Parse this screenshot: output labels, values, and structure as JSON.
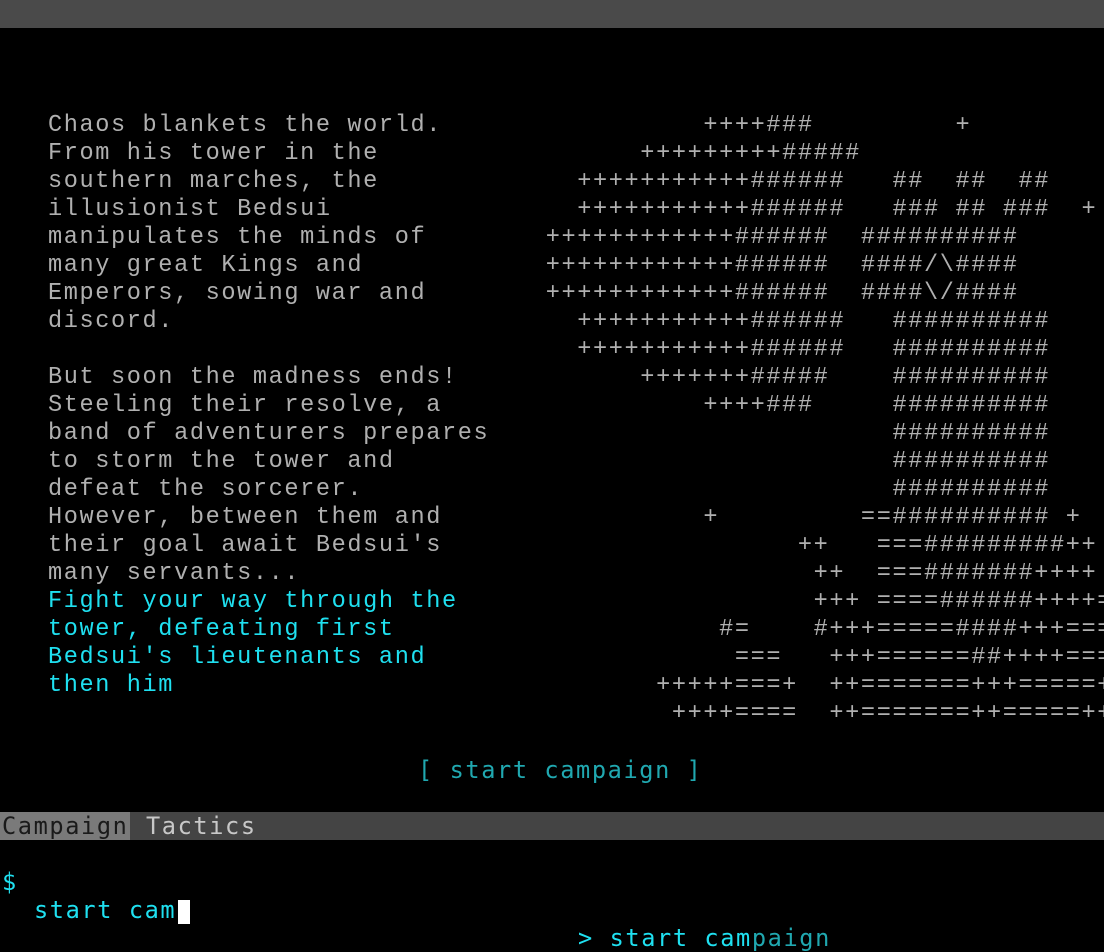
{
  "intro": {
    "story": "Chaos blankets the world.\nFrom his tower in the\nsouthern marches, the\nillusionist Bedsui\nmanipulates the minds of\nmany great Kings and\nEmperors, sowing war and\ndiscord.\n\nBut soon the madness ends!\nSteeling their resolve, a\nband of adventurers prepares\nto storm the tower and\ndefeat the sorcerer.\nHowever, between them and\ntheir goal await Bedsui's\nmany servants...\n",
    "goal": "Fight your way through the\ntower, defeating first\nBedsui's lieutenants and\nthen him"
  },
  "art": "           ++++###         +\n       +++++++++#####\n   +++++++++++######   ##  ##  ##\n   +++++++++++######   ### ## ###  +\n ++++++++++++######  ##########\n ++++++++++++######  ####/\\####\n ++++++++++++######  ####\\/####\n   +++++++++++######   ##########\n   +++++++++++######   ##########\n       +++++++#####    ##########\n           ++++###     ##########\n                       ##########\n                       ##########\n                       ##########\n           +         ==########## +\n                 ++   ===#########++\n                  ++  ===#######++++\n                  +++ ====######++++==\n            #=    #+++=====####+++===\n             ===   +++======##++++===++\n        +++++===+  ++=======+++=====++\n         ++++====  ++=======++=====++++",
  "start_button_label": "[ start campaign ]",
  "tabs": {
    "campaign": "Campaign",
    "tactics": "Tactics"
  },
  "command": {
    "prompt": "$",
    "input": "start cam",
    "suggestion_prefix": "> ",
    "suggestion_typed": "start cam",
    "suggestion_rest": "paign"
  },
  "colors": {
    "background": "#000000",
    "story_text": "#b0b0b0",
    "highlight": "#1fe0f0",
    "button": "#20a8b0"
  }
}
